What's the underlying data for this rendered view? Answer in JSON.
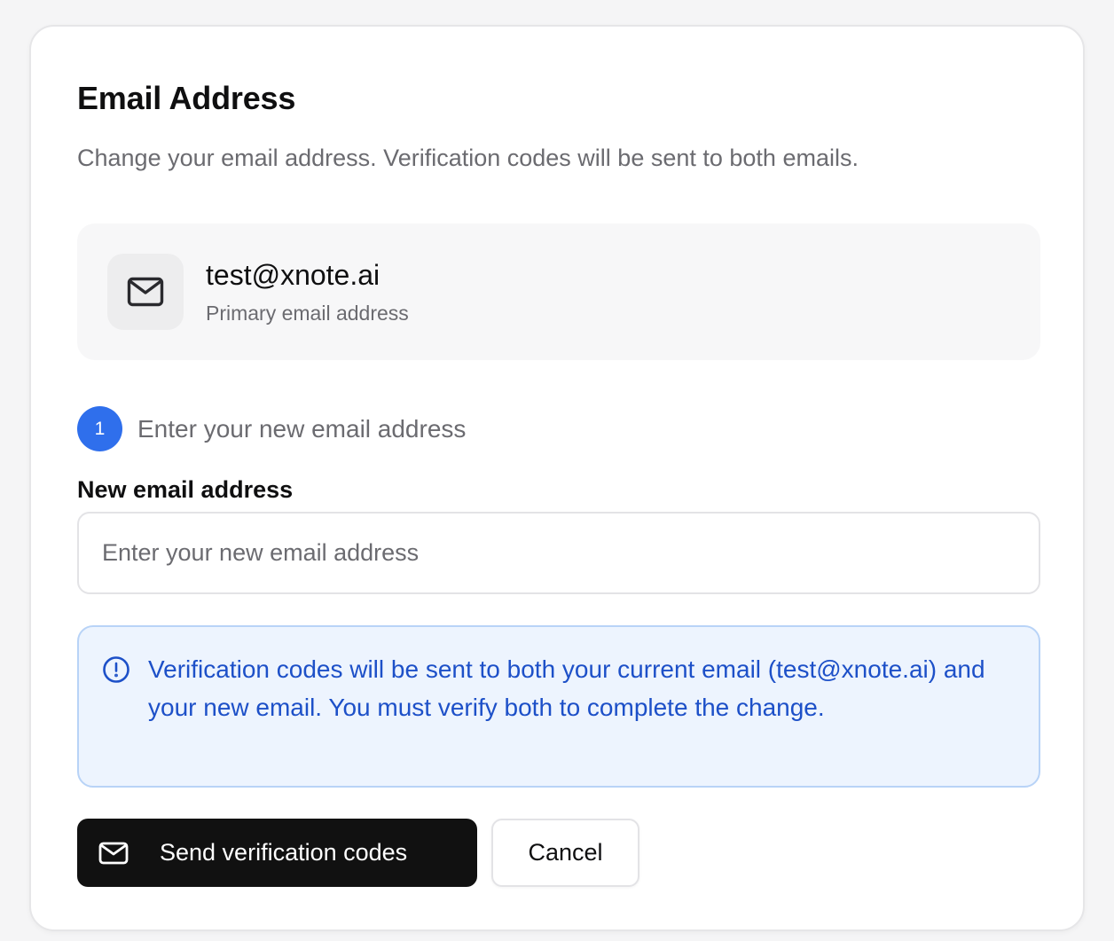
{
  "section": {
    "title": "Email Address",
    "description": "Change your email address. Verification codes will be sent to both emails."
  },
  "current_email": {
    "icon": "mail-icon",
    "address": "test@xnote.ai",
    "caption": "Primary email address"
  },
  "step": {
    "number": "1",
    "label": "Enter your new email address"
  },
  "new_email_field": {
    "label": "New email address",
    "value": "",
    "placeholder": "Enter your new email address"
  },
  "notice": {
    "icon": "info-circle-icon",
    "text": "Verification codes will be sent to both your current email (test@xnote.ai) and your new email. You must verify both to complete the change."
  },
  "actions": {
    "send_icon": "mail-icon",
    "send_label": "Send verification codes",
    "cancel_label": "Cancel"
  },
  "colors": {
    "accent": "#2f6fec",
    "notice_text": "#1d50c8",
    "notice_bg": "#edf4fe",
    "primary_button": "#111111"
  }
}
